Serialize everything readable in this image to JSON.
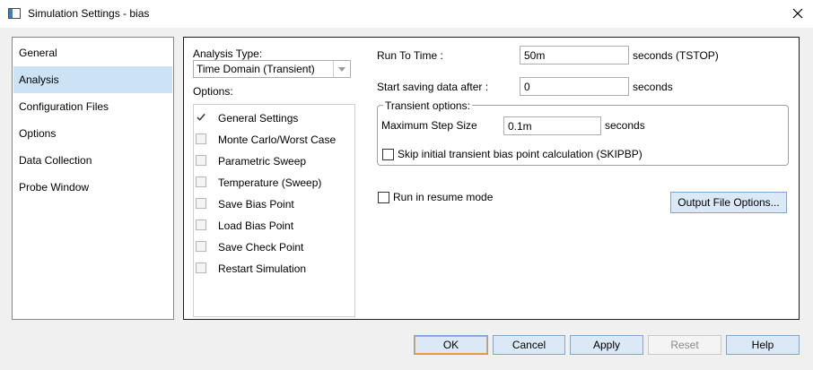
{
  "window": {
    "title": "Simulation Settings - bias"
  },
  "nav": {
    "items": [
      {
        "label": "General"
      },
      {
        "label": "Analysis"
      },
      {
        "label": "Configuration Files"
      },
      {
        "label": "Options"
      },
      {
        "label": "Data Collection"
      },
      {
        "label": "Probe Window"
      }
    ],
    "selected": "Analysis"
  },
  "analysis": {
    "type_label": "Analysis Type:",
    "type_value": "Time Domain (Transient)",
    "options_label": "Options:",
    "options": [
      {
        "label": "General Settings",
        "checked": true
      },
      {
        "label": "Monte Carlo/Worst Case",
        "checked": false
      },
      {
        "label": "Parametric Sweep",
        "checked": false
      },
      {
        "label": "Temperature (Sweep)",
        "checked": false
      },
      {
        "label": "Save Bias Point",
        "checked": false
      },
      {
        "label": "Load Bias Point",
        "checked": false
      },
      {
        "label": "Save Check Point",
        "checked": false
      },
      {
        "label": "Restart Simulation",
        "checked": false
      }
    ]
  },
  "settings": {
    "run_to_time_label": "Run To Time :",
    "run_to_time_value": "50m",
    "run_to_time_unit": "seconds (TSTOP)",
    "start_saving_label": "Start saving data after :",
    "start_saving_value": "0",
    "start_saving_unit": "seconds",
    "transient_legend": "Transient options:",
    "max_step_label": "Maximum Step Size",
    "max_step_value": "0.1m",
    "max_step_unit": "seconds",
    "skipbp_label": "Skip initial transient bias point calculation (SKIPBP)",
    "skipbp_checked": false,
    "resume_label": "Run in resume mode",
    "resume_checked": false,
    "output_file_options": "Output File Options..."
  },
  "buttons": {
    "ok": "OK",
    "cancel": "Cancel",
    "apply": "Apply",
    "reset": "Reset",
    "help": "Help"
  }
}
